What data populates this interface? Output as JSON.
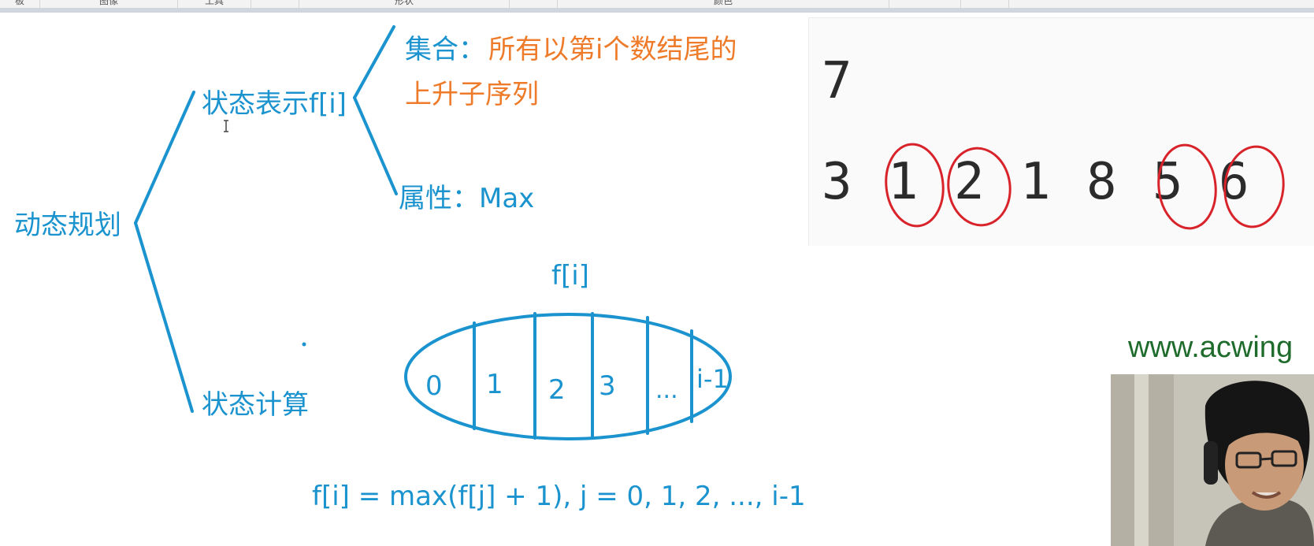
{
  "toolbar": {
    "tabs": [
      "板",
      "图像",
      "工具",
      "",
      "形状",
      "",
      "颜色",
      "",
      ""
    ]
  },
  "diagram": {
    "root": "动态规划",
    "state_repr": "状态表示f[i]",
    "set_label": "集合：",
    "set_text_line1": "所有以第i个数结尾的",
    "set_text_line2": "上升子序列",
    "attribute": "属性：Max",
    "state_calc": "状态计算",
    "array_title": "f[i]",
    "array_cells": [
      "0",
      "1",
      "2",
      "3",
      "...",
      "i-1"
    ],
    "formula": "f[i]  =  max(f[j]  +  1), j  =  0, 1, 2, ..., i-1",
    "line_color": "#1b93cf",
    "highlight_color": "#ee7b2a"
  },
  "sample": {
    "n": "7",
    "sequence": [
      "3",
      "1",
      "2",
      "1",
      "8",
      "5",
      "6"
    ],
    "circled": [
      1,
      2,
      5,
      6
    ],
    "circle_color": "#d8232a"
  },
  "watermark": "www.acwing"
}
